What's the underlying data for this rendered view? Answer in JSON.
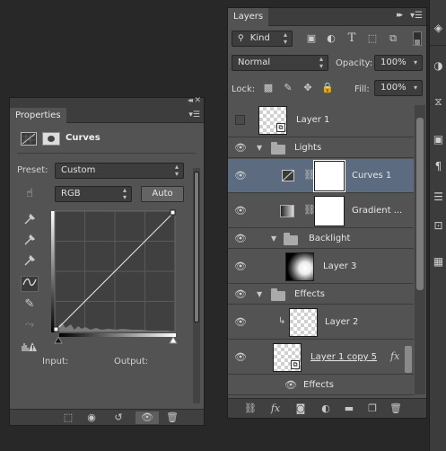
{
  "properties": {
    "tab_label": "Properties",
    "adjustment_title": "Curves",
    "preset_label": "Preset:",
    "preset_value": "Custom",
    "channel_value": "RGB",
    "auto_label": "Auto",
    "input_label": "Input:",
    "output_label": "Output:",
    "bottom_icons": [
      "clip-to-layer-icon",
      "view-previous-icon",
      "reset-icon",
      "visibility-icon",
      "delete-icon"
    ]
  },
  "layers": {
    "tab_label": "Layers",
    "kind_label": "Kind",
    "filter_icons": [
      "pixel-filter-icon",
      "adjustment-filter-icon",
      "type-filter-icon",
      "shape-filter-icon",
      "smart-object-filter-icon"
    ],
    "blend_mode": "Normal",
    "opacity_label": "Opacity:",
    "opacity_value": "100%",
    "lock_label": "Lock:",
    "fill_label": "Fill:",
    "fill_value": "100%",
    "items": [
      {
        "name": "Layer 1",
        "kind": "layer",
        "visible": false
      },
      {
        "name": "Lights",
        "kind": "group",
        "visible": true
      },
      {
        "name": "Curves 1",
        "kind": "adjustment",
        "visible": true,
        "selected": true
      },
      {
        "name": "Gradient ...",
        "kind": "adjustment",
        "visible": true
      },
      {
        "name": "Backlight",
        "kind": "group",
        "visible": true
      },
      {
        "name": "Layer 3",
        "kind": "layer",
        "visible": true
      },
      {
        "name": "Effects",
        "kind": "group",
        "visible": true
      },
      {
        "name": "Layer 2",
        "kind": "layer",
        "visible": true
      },
      {
        "name": "Layer 1 copy 5",
        "kind": "smart-object",
        "visible": true,
        "fx": "fx"
      },
      {
        "name": "Effects",
        "kind": "effects",
        "visible": true
      }
    ],
    "bottom_icons": [
      "link-layers-icon",
      "layer-style-icon",
      "add-mask-icon",
      "new-adjustment-icon",
      "new-group-icon",
      "new-layer-icon",
      "delete-layer-icon"
    ]
  },
  "colors": {
    "panel_bg": "#535353",
    "selected_row": "#5d6b80",
    "app_bg": "#282828"
  }
}
